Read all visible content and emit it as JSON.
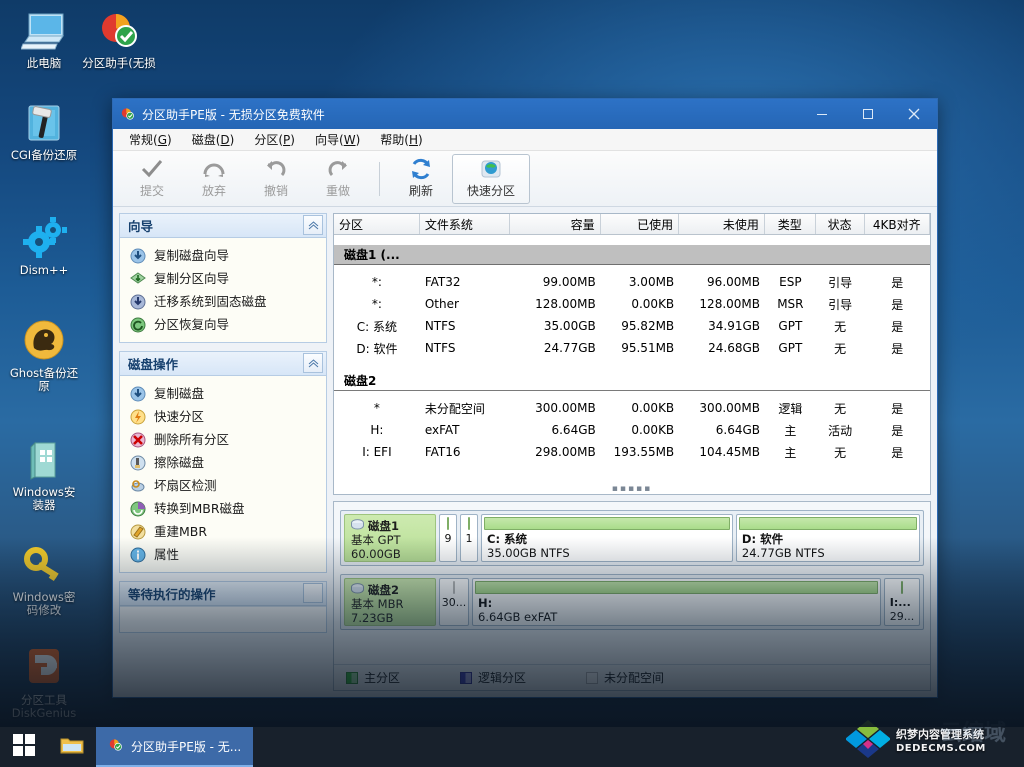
{
  "desktop": {
    "icons": [
      {
        "name": "this-pc",
        "label": "此电脑",
        "icon": "monitor-icon"
      },
      {
        "name": "partition-assistant",
        "label": "分区助手(无损",
        "icon": "partition-assistant-icon"
      },
      {
        "name": "cgi-backup",
        "label": "CGI备份还原",
        "icon": "hammer-icon"
      },
      {
        "name": "dism-plus",
        "label": "Dism++",
        "icon": "gears-icon"
      },
      {
        "name": "ghost-backup",
        "label": "Ghost备份还\n原",
        "icon": "ghost-icon"
      },
      {
        "name": "windows-installer",
        "label": "Windows安\n装器",
        "icon": "installer-icon"
      },
      {
        "name": "windows-password",
        "label": "Windows密\n码修改",
        "icon": "key-icon"
      },
      {
        "name": "diskgenius",
        "label": "分区工具\nDiskGenius",
        "icon": "diskgenius-icon"
      }
    ]
  },
  "window": {
    "title": "分区助手PE版 - 无损分区免费软件",
    "minimize": "–",
    "maximize": "□",
    "close": "✕",
    "menus": [
      {
        "text": "常规",
        "accel": "G"
      },
      {
        "text": "磁盘",
        "accel": "D"
      },
      {
        "text": "分区",
        "accel": "P"
      },
      {
        "text": "向导",
        "accel": "W"
      },
      {
        "text": "帮助",
        "accel": "H"
      }
    ],
    "toolbar": [
      {
        "name": "commit",
        "label": "提交",
        "icon": "check-icon",
        "disabled": true
      },
      {
        "name": "discard",
        "label": "放弃",
        "icon": "discard-icon",
        "disabled": true
      },
      {
        "name": "undo",
        "label": "撤销",
        "icon": "undo-icon",
        "disabled": true
      },
      {
        "name": "redo",
        "label": "重做",
        "icon": "redo-icon",
        "disabled": true
      },
      {
        "name": "refresh",
        "label": "刷新",
        "icon": "refresh-icon",
        "disabled": false
      },
      {
        "name": "quick-partition",
        "label": "快速分区",
        "icon": "globe-icon",
        "disabled": false
      }
    ]
  },
  "sidebar": {
    "panels": [
      {
        "name": "wizard",
        "title": "向导",
        "collapse": "⌃",
        "items": [
          {
            "label": "复制磁盘向导",
            "icon": "copy-disk-icon"
          },
          {
            "label": "复制分区向导",
            "icon": "copy-partition-icon"
          },
          {
            "label": "迁移系统到固态磁盘",
            "icon": "migrate-os-icon"
          },
          {
            "label": "分区恢复向导",
            "icon": "recover-partition-icon"
          }
        ]
      },
      {
        "name": "disk-operations",
        "title": "磁盘操作",
        "collapse": "⌃",
        "items": [
          {
            "label": "复制磁盘",
            "icon": "copy-disk-icon"
          },
          {
            "label": "快速分区",
            "icon": "lightning-icon"
          },
          {
            "label": "删除所有分区",
            "icon": "delete-icon"
          },
          {
            "label": "擦除磁盘",
            "icon": "wipe-icon"
          },
          {
            "label": "坏扇区检测",
            "icon": "badsector-icon"
          },
          {
            "label": "转换到MBR磁盘",
            "icon": "convert-icon"
          },
          {
            "label": "重建MBR",
            "icon": "rebuild-mbr-icon"
          },
          {
            "label": "属性",
            "icon": "info-icon"
          }
        ]
      },
      {
        "name": "pending-operations",
        "title": "等待执行的操作",
        "collapse": "",
        "items": []
      }
    ]
  },
  "partition_table": {
    "columns": [
      "分区",
      "文件系统",
      "容量",
      "已使用",
      "未使用",
      "类型",
      "状态",
      "4KB对齐"
    ],
    "groups": [
      {
        "name": "磁盘1 (...",
        "rows": [
          {
            "partition": "*:",
            "fs": "FAT32",
            "capacity": "99.00MB",
            "used": "3.00MB",
            "unused": "96.00MB",
            "type": "ESP",
            "status": "引导",
            "aligned": "是"
          },
          {
            "partition": "*:",
            "fs": "Other",
            "capacity": "128.00MB",
            "used": "0.00KB",
            "unused": "128.00MB",
            "type": "MSR",
            "status": "引导",
            "aligned": "是"
          },
          {
            "partition": "C: 系统",
            "fs": "NTFS",
            "capacity": "35.00GB",
            "used": "95.82MB",
            "unused": "34.91GB",
            "type": "GPT",
            "status": "无",
            "aligned": "是"
          },
          {
            "partition": "D: 软件",
            "fs": "NTFS",
            "capacity": "24.77GB",
            "used": "95.51MB",
            "unused": "24.68GB",
            "type": "GPT",
            "status": "无",
            "aligned": "是"
          }
        ]
      },
      {
        "name": "磁盘2",
        "rows": [
          {
            "partition": "*",
            "fs": "未分配空间",
            "capacity": "300.00MB",
            "used": "0.00KB",
            "unused": "300.00MB",
            "type": "逻辑",
            "status": "无",
            "aligned": "是"
          },
          {
            "partition": "H:",
            "fs": "exFAT",
            "capacity": "6.64GB",
            "used": "0.00KB",
            "unused": "6.64GB",
            "type": "主",
            "status": "活动",
            "aligned": "是"
          },
          {
            "partition": "I: EFI",
            "fs": "FAT16",
            "capacity": "298.00MB",
            "used": "193.55MB",
            "unused": "104.45MB",
            "type": "主",
            "status": "无",
            "aligned": "是"
          }
        ]
      }
    ]
  },
  "disk_map": {
    "disks": [
      {
        "name": "磁盘1",
        "type": "基本 GPT",
        "size": "60.00GB",
        "partitions": [
          {
            "name": "",
            "sub": "9",
            "tiny": true,
            "flex": 0,
            "fillpct": 0,
            "style": "green"
          },
          {
            "name": "",
            "sub": "1",
            "tiny": true,
            "flex": 0,
            "fillpct": 0,
            "style": "green"
          },
          {
            "name": "C: 系统",
            "sub": "35.00GB NTFS",
            "tiny": false,
            "flex": 58,
            "fillpct": 1,
            "style": "green"
          },
          {
            "name": "D: 软件",
            "sub": "24.77GB NTFS",
            "tiny": false,
            "flex": 42,
            "fillpct": 1,
            "style": "green"
          }
        ]
      },
      {
        "name": "磁盘2",
        "type": "基本 MBR",
        "size": "7.23GB",
        "partitions": [
          {
            "name": "",
            "sub": "30...",
            "tiny": true,
            "flex": 0,
            "fillpct": 0,
            "style": "hatch"
          },
          {
            "name": "H:",
            "sub": "6.64GB exFAT",
            "tiny": false,
            "flex": 92,
            "fillpct": 1,
            "style": "green"
          },
          {
            "name": "I:...",
            "sub": "29...",
            "tiny": true,
            "flex": 0,
            "fillpct": 65,
            "style": "green-filled"
          }
        ]
      }
    ],
    "legend": [
      {
        "label": "主分区",
        "swatch": "sw-main"
      },
      {
        "label": "逻辑分区",
        "swatch": "sw-logic"
      },
      {
        "label": "未分配空间",
        "swatch": "sw-unalloc"
      }
    ]
  },
  "taskbar": {
    "start": "start-icon",
    "file_explorer": "folder-icon",
    "task_label": "分区助手PE版 - 无..."
  },
  "watermark": {
    "line1": "织梦内容管理系统",
    "line2": "DEDECMS.COM",
    "ghost": "云绾域"
  },
  "colors": {
    "accent": "#2d72c6",
    "titlebar": "#2566b5",
    "green": "#a9dc8a",
    "taskbar": "#18212c"
  }
}
